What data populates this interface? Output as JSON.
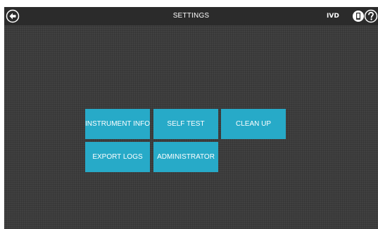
{
  "header": {
    "title": "SETTINGS",
    "badge": "IVD",
    "back_icon": "back-arrow-circle-icon",
    "device_icon": "device-icon",
    "help_icon": "help-circle-icon"
  },
  "menu": {
    "items": [
      {
        "label": "INSTRUMENT INFO"
      },
      {
        "label": "SELF TEST"
      },
      {
        "label": "CLEAN UP"
      },
      {
        "label": "EXPORT LOGS"
      },
      {
        "label": "ADMINISTRATOR"
      }
    ]
  },
  "colors": {
    "background": "#414141",
    "topbar": "#2b2b2b",
    "tile": "#27aac8",
    "text": "#ffffff"
  }
}
